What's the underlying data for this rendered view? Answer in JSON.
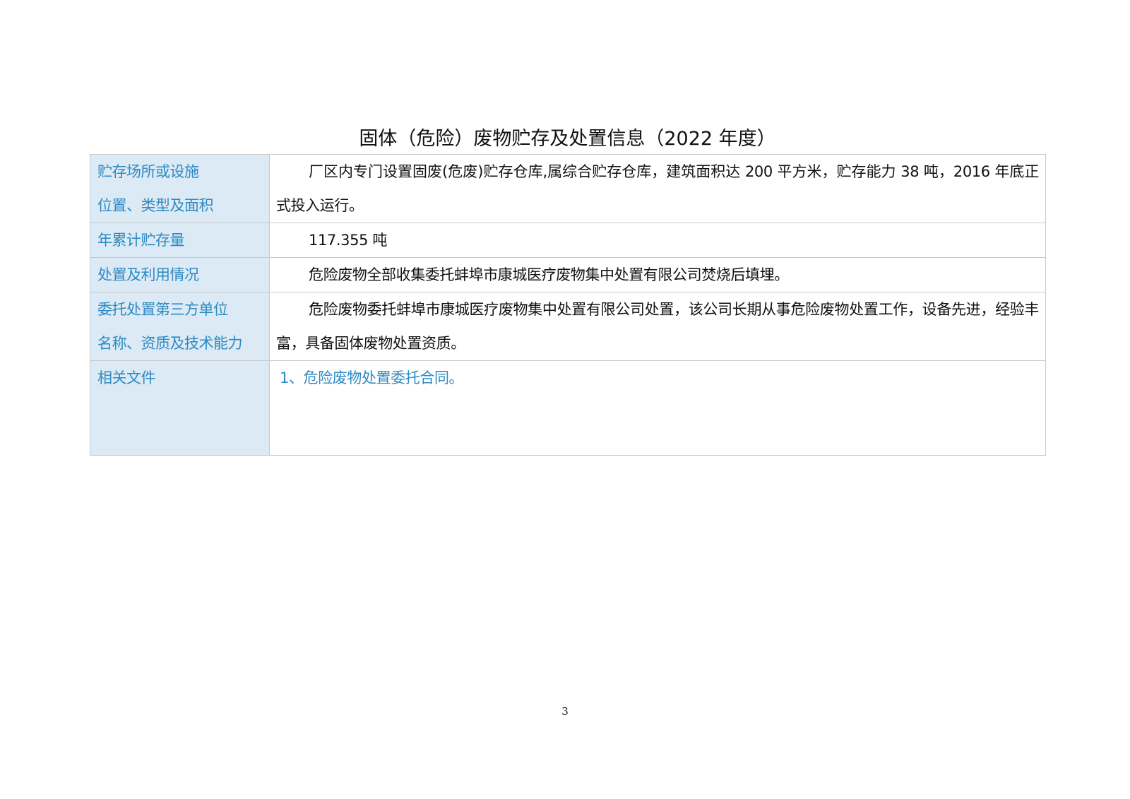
{
  "document": {
    "title": "固体（危险）废物贮存及处置信息（2022 年度）",
    "page_number": "3"
  },
  "table": {
    "rows": [
      {
        "label": "贮存场所或设施\n位置、类型及面积",
        "value": "厂区内专门设置固废(危废)贮存仓库,属综合贮存仓库，建筑面积达 200 平方米，贮存能力 38 吨，2016 年底正式投入运行。"
      },
      {
        "label": "年累计贮存量",
        "value": "117.355 吨"
      },
      {
        "label": "处置及利用情况",
        "value": "危险废物全部收集委托蚌埠市康城医疗废物集中处置有限公司焚烧后填埋。"
      },
      {
        "label": "委托处置第三方单位\n名称、资质及技术能力",
        "value": "危险废物委托蚌埠市康城医疗废物集中处置有限公司处置，该公司长期从事危险废物处置工作，设备先进，经验丰富，具备固体废物处置资质。"
      },
      {
        "label": "相关文件",
        "value": "1、危险废物处置委托合同。"
      }
    ]
  },
  "colors": {
    "label_background": "#dbeaf4",
    "label_text": "#2e8ac2",
    "border": "#c8c8c8"
  }
}
